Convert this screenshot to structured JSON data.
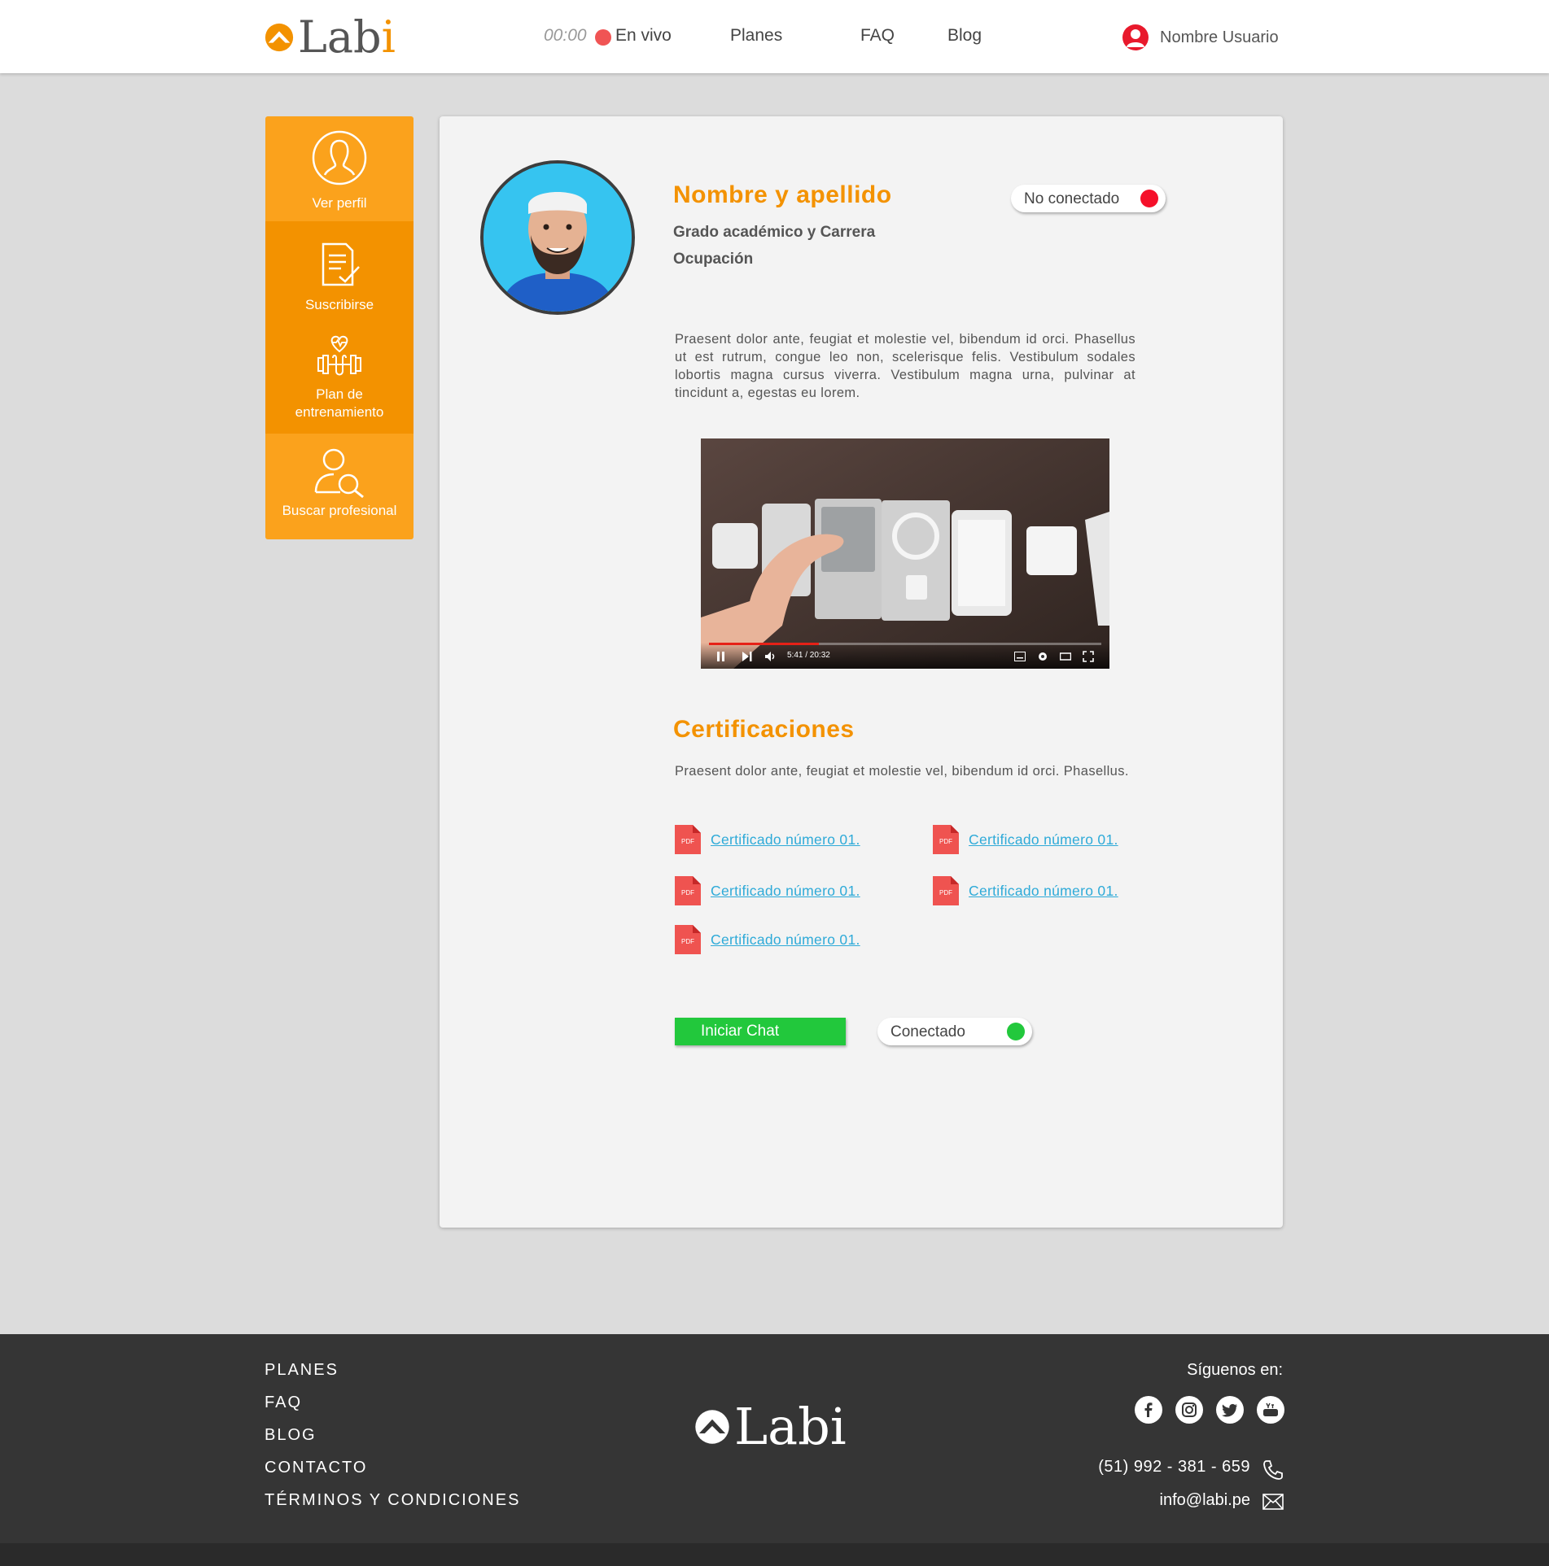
{
  "header": {
    "brand": "Labi",
    "time": "00:00",
    "live_label": "En vivo",
    "nav": [
      "Planes",
      "FAQ",
      "Blog"
    ],
    "user_name": "Nombre Usuario"
  },
  "sidebar": {
    "items": [
      {
        "label": "Ver perfil",
        "icon": "profile-icon",
        "color": "#fba21c"
      },
      {
        "label": "Suscribirse",
        "icon": "checklist-icon",
        "color": "#f39200"
      },
      {
        "label": "Plan de\nentrenamiento",
        "icon": "dumbbell-heart-icon",
        "color": "#f39200"
      },
      {
        "label": "Buscar profesional",
        "icon": "search-user-icon",
        "color": "#fba21c"
      }
    ]
  },
  "profile": {
    "name": "Nombre y apellido",
    "status_offline": "No conectado",
    "grade": "Grado académico y Carrera",
    "occupation": "Ocupación",
    "description": "Praesent dolor ante, feugiat et molestie vel, bibendum id orci. Phasellus ut est rutrum, congue leo non, scelerisque felis. Vestibulum sodales lobortis magna cursus viverra. Vestibulum magna urna, pulvinar at tincidunt a, egestas eu lorem."
  },
  "video": {
    "time": "5:41 / 20:32",
    "progress": 0.28
  },
  "certifications": {
    "title": "Certificaciones",
    "description": "Praesent dolor ante, feugiat et molestie vel, bibendum id orci. Phasellus.",
    "pdf_badge": "PDF",
    "items": [
      "Certificado número 01.",
      "Certificado número 01.",
      "Certificado número 01.",
      "Certificado número 01.",
      "Certificado número 01."
    ]
  },
  "actions": {
    "chat_label": "Iniciar Chat",
    "status_online": "Conectado"
  },
  "footer": {
    "links": [
      "PLANES",
      "FAQ",
      "BLOG",
      "CONTACTO",
      "TÉRMINOS Y CONDICIONES"
    ],
    "brand": "Labi",
    "follow_label": "Síguenos en:",
    "social": [
      "facebook-icon",
      "instagram-icon",
      "twitter-icon",
      "youtube-icon"
    ],
    "phone": "(51) 992 - 381 - 659",
    "email": "info@labi.pe"
  },
  "colors": {
    "accent": "#f39200",
    "online": "#22c83c",
    "offline": "#f5102a",
    "link": "#2eaad8"
  }
}
